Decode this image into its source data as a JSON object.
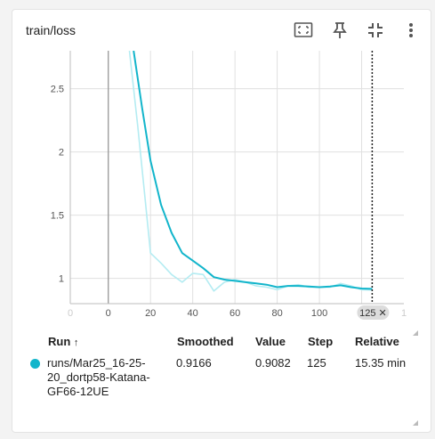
{
  "card": {
    "title": "train/loss"
  },
  "toolbar": {
    "fit_domain_icon": "fit-to-domain-icon",
    "pin_icon": "pin-icon",
    "collapse_icon": "fullscreen-exit-icon",
    "more_icon": "more-vert-icon"
  },
  "chart_data": {
    "type": "line",
    "xlabel": "",
    "ylabel": "",
    "x_ticks": [
      "0",
      "20",
      "40",
      "60",
      "80",
      "100",
      "1"
    ],
    "x_ticks_faded": [
      "0",
      "1"
    ],
    "y_ticks": [
      "1",
      "1.5",
      "2",
      "2.5"
    ],
    "xlim": [
      -18,
      140
    ],
    "ylim": [
      0.8,
      2.8
    ],
    "grid": true,
    "hover_step": 125,
    "hover_label": "125 ✕",
    "series": [
      {
        "name": "",
        "color": "#12b5cb",
        "kind": "smoothed",
        "x": [
          12,
          16,
          20,
          25,
          30,
          35,
          40,
          45,
          50,
          55,
          60,
          65,
          70,
          75,
          80,
          85,
          90,
          95,
          100,
          105,
          110,
          115,
          120,
          125
        ],
        "y": [
          2.8,
          2.35,
          1.93,
          1.58,
          1.36,
          1.2,
          1.14,
          1.08,
          1.01,
          0.99,
          0.98,
          0.97,
          0.96,
          0.95,
          0.93,
          0.94,
          0.94,
          0.935,
          0.93,
          0.935,
          0.945,
          0.93,
          0.92,
          0.9166
        ]
      },
      {
        "name": "",
        "color": "#b4ecf2",
        "kind": "raw",
        "x": [
          10,
          14,
          17,
          20,
          25,
          30,
          35,
          40,
          45,
          50,
          55,
          60,
          65,
          70,
          75,
          80,
          85,
          90,
          95,
          100,
          105,
          110,
          115,
          120,
          125
        ],
        "y": [
          2.8,
          2.2,
          1.7,
          1.2,
          1.12,
          1.03,
          0.97,
          1.04,
          1.03,
          0.9,
          0.97,
          0.99,
          0.97,
          0.94,
          0.93,
          0.91,
          0.94,
          0.95,
          0.93,
          0.93,
          0.93,
          0.96,
          0.94,
          0.91,
          0.9082
        ]
      }
    ]
  },
  "table": {
    "headers": {
      "run": "Run",
      "run_sort_arrow": "↑",
      "smoothed": "Smoothed",
      "value": "Value",
      "step": "Step",
      "relative": "Relative"
    },
    "rows": [
      {
        "run_line1": "runs/Mar25_16-25-",
        "run_line2": "20_dortp58-Katana-",
        "run_line3": "GF66-12UE",
        "smoothed": "0.9166",
        "value": "0.9082",
        "step": "125",
        "relative": "15.35 min",
        "color": "#12b5cb"
      }
    ]
  }
}
